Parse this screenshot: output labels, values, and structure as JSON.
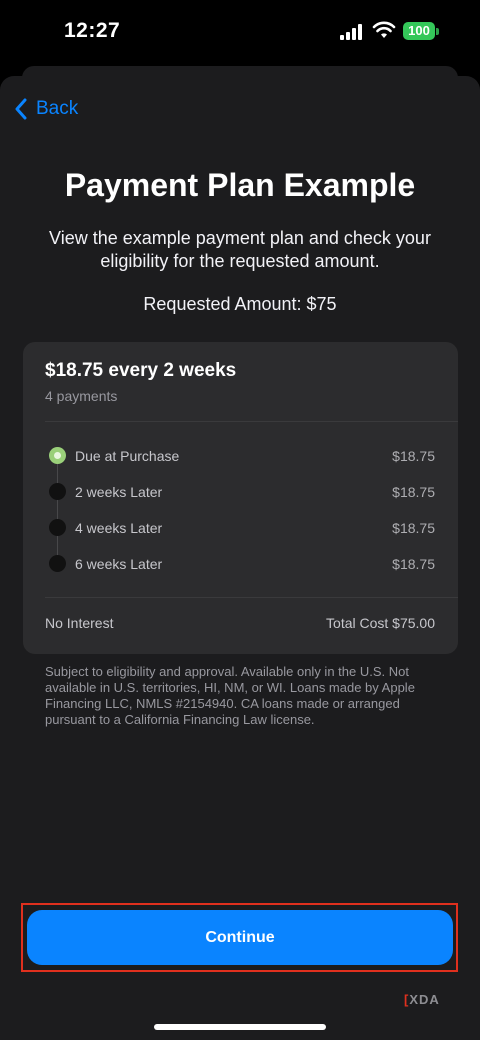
{
  "status_bar": {
    "time": "12:27",
    "battery": "100",
    "icons": [
      "signal-icon",
      "wifi-icon",
      "battery-icon"
    ]
  },
  "nav": {
    "back_label": "Back",
    "back_icon": "chevron-left-icon"
  },
  "header": {
    "title": "Payment Plan Example",
    "subtitle": "View the example payment plan and check your eligibility for the requested amount.",
    "requested_amount": "Requested Amount: $75"
  },
  "plan": {
    "headline": "$18.75 every 2 weeks",
    "payment_count": "4 payments",
    "schedule": [
      {
        "label": "Due at Purchase",
        "amount": "$18.75",
        "active": true
      },
      {
        "label": "2 weeks Later",
        "amount": "$18.75",
        "active": false
      },
      {
        "label": "4 weeks Later",
        "amount": "$18.75",
        "active": false
      },
      {
        "label": "6 weeks Later",
        "amount": "$18.75",
        "active": false
      }
    ],
    "interest": "No Interest",
    "total_cost": "Total Cost $75.00"
  },
  "disclaimer": "Subject to eligibility and approval. Available only in the U.S. Not available in U.S. territories, HI, NM, or WI. Loans made by Apple Financing LLC, NMLS #2154940. CA loans made or arranged pursuant to a California Financing Law license.",
  "actions": {
    "continue_label": "Continue"
  },
  "watermark": {
    "left": "[",
    "brand": "XDA"
  },
  "colors": {
    "accent": "#0a84ff",
    "sheet_background": "#1c1c1e",
    "card_background": "#2c2c2e",
    "active_dot": "#9ad07a",
    "highlight_border": "#e0301e",
    "battery": "#34c759"
  }
}
